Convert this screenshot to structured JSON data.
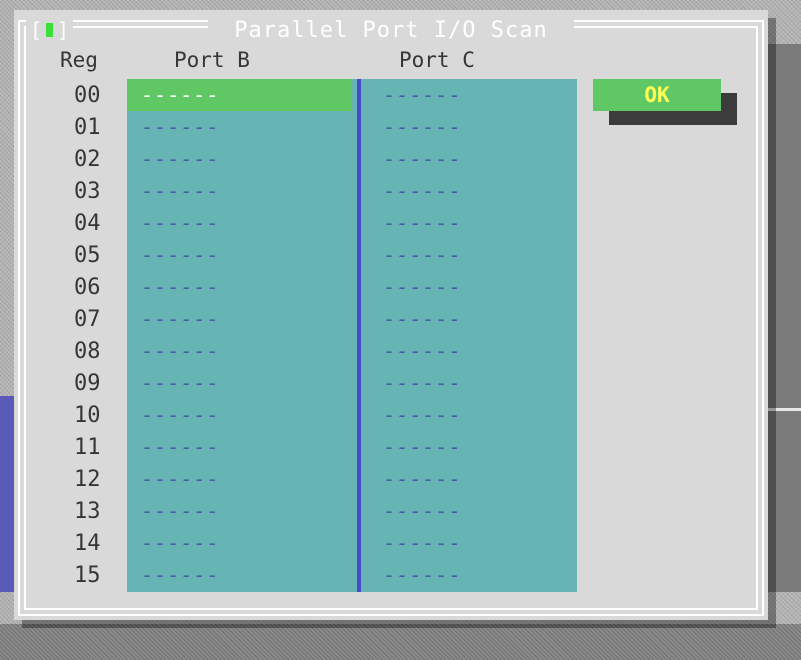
{
  "dialog": {
    "title": " Parallel Port I/O Scan ",
    "close_box_left": "[",
    "close_box_right": "]"
  },
  "headers": {
    "reg": "Reg",
    "port_b": "Port B",
    "port_c": "Port C"
  },
  "rows": [
    {
      "reg": "00",
      "port_b": "------",
      "port_c": "------"
    },
    {
      "reg": "01",
      "port_b": "------",
      "port_c": "------"
    },
    {
      "reg": "02",
      "port_b": "------",
      "port_c": "------"
    },
    {
      "reg": "03",
      "port_b": "------",
      "port_c": "------"
    },
    {
      "reg": "04",
      "port_b": "------",
      "port_c": "------"
    },
    {
      "reg": "05",
      "port_b": "------",
      "port_c": "------"
    },
    {
      "reg": "06",
      "port_b": "------",
      "port_c": "------"
    },
    {
      "reg": "07",
      "port_b": "------",
      "port_c": "------"
    },
    {
      "reg": "08",
      "port_b": "------",
      "port_c": "------"
    },
    {
      "reg": "09",
      "port_b": "------",
      "port_c": "------"
    },
    {
      "reg": "10",
      "port_b": "------",
      "port_c": "------"
    },
    {
      "reg": "11",
      "port_b": "------",
      "port_c": "------"
    },
    {
      "reg": "12",
      "port_b": "------",
      "port_c": "------"
    },
    {
      "reg": "13",
      "port_b": "------",
      "port_c": "------"
    },
    {
      "reg": "14",
      "port_b": "------",
      "port_c": "------"
    },
    {
      "reg": "15",
      "port_b": "------",
      "port_c": "------"
    }
  ],
  "selected_row": "00",
  "ok_button": {
    "label": "OK"
  },
  "colors": {
    "dialog_bg": "#d9d9d9",
    "list_bg": "#66b4b4",
    "selection": "#5fc864",
    "divider": "#4848c8",
    "ok_text": "#ffff55"
  }
}
